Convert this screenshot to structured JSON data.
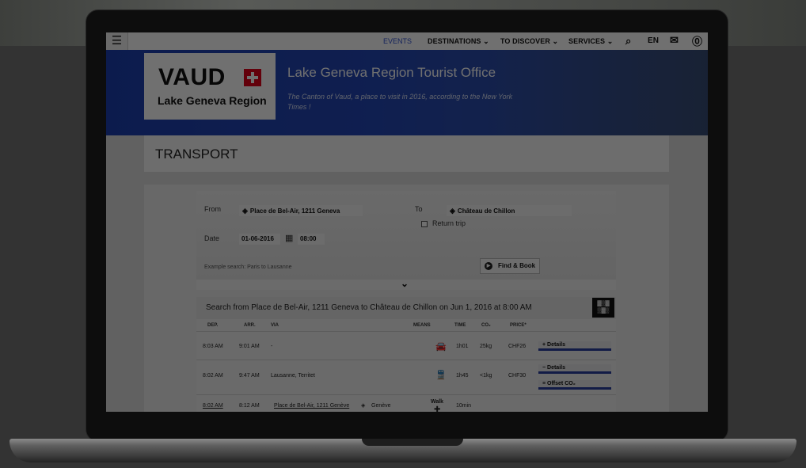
{
  "nav": {
    "menu_icon": "hamburger-icon",
    "events": "EVENTS",
    "destinations": "DESTINATIONS ⌄",
    "to_discover": "TO DISCOVER ⌄",
    "services": "SERVICES ⌄",
    "language": "EN",
    "icons": [
      "search-icon",
      "mail-icon",
      "help-icon"
    ]
  },
  "hero": {
    "logo_main": "VAUD",
    "logo_sub": "Lake Geneva Region",
    "title": "Lake Geneva Region Tourist Office",
    "subtitle": "The Canton of Vaud, a place to visit in 2016, according to the New York Times !"
  },
  "page": {
    "title": "TRANSPORT"
  },
  "form": {
    "from_label": "From",
    "from_value": "Place de Bel-Air, 1211 Geneva",
    "to_label": "To",
    "to_value": "Château de Chillon",
    "return_label": "Return trip",
    "date_label": "Date",
    "date_value": "01-06-2016",
    "time_value": "08:00",
    "example": "Example search: Paris to Lausanne",
    "find_book": "Find & Book",
    "toggle": "⌄"
  },
  "results": {
    "header": "Search from Place de Bel-Air, 1211 Geneva to Château de Chillon on Jun 1, 2016 at 8:00 AM",
    "qr": "▓▒▓\n▒▓▒",
    "columns": [
      "DEP.",
      "ARR.",
      "VIA",
      "MEANS",
      "TIME",
      "CO₂",
      "PRICE*"
    ],
    "rows": [
      {
        "dep": "8:03 AM",
        "arr": "9:01 AM",
        "via": "-",
        "means": "car-icon",
        "time": "1h01",
        "co2": "25kg",
        "price": "CHF26",
        "buttons": [
          "+ Details"
        ]
      },
      {
        "dep": "8:02 AM",
        "arr": "9:47 AM",
        "via": "Lausanne, Territet",
        "means": "train-icon",
        "time": "1h45",
        "co2": "<1kg",
        "price": "CHF30",
        "buttons": [
          "− Details",
          "≡ Offset CO₂"
        ]
      },
      {
        "dep": "8:02 AM",
        "arr": "8:12 AM",
        "via": "Place de Bel-Air, 1211 Genève",
        "via_dest": "Genève",
        "means": "Walk",
        "time": "10min",
        "co2": "",
        "price": "",
        "buttons": []
      }
    ]
  },
  "colors": {
    "hero_blue": "#2447b6",
    "swiss_red": "#e2001a",
    "button_underline": "#2a3fa0"
  }
}
